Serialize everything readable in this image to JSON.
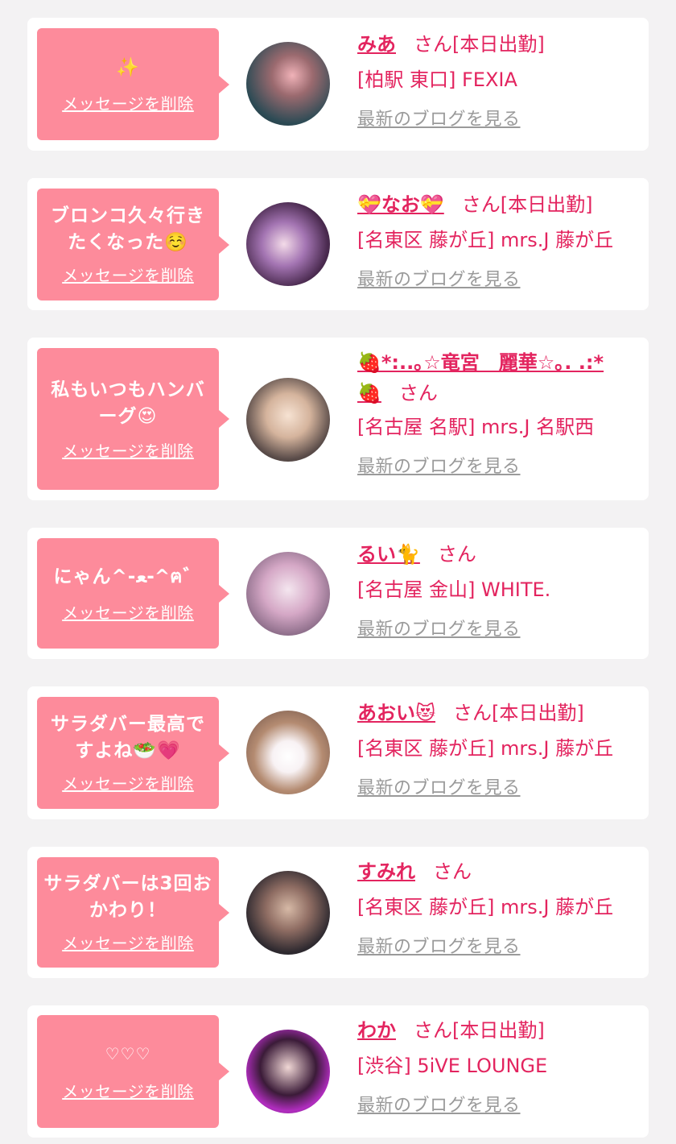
{
  "delete_label": "メッセージを削除",
  "blog_label": "最新のブログを見る",
  "san_label": "さん",
  "cards": [
    {
      "message": "✨",
      "name": "みあ",
      "status": "[本日出勤]",
      "shop": "[柏駅 東口] FEXIA"
    },
    {
      "message": "ブロンコ久々行きたくなった☺️",
      "name": "💝なお💝",
      "status": "[本日出勤]",
      "shop": "[名東区 藤が丘] mrs.J 藤が丘"
    },
    {
      "message": "私もいつもハンバーグ😍",
      "name": "🍓*:..｡☆竜宮　麗華☆｡. .:*🍓",
      "status": "",
      "shop": "[名古屋 名駅] mrs.J 名駅西"
    },
    {
      "message": "にゃん^-ﻌ-^ฅ゛",
      "name": "るい🐈",
      "status": "",
      "shop": "[名古屋 金山] WHITE."
    },
    {
      "message": "サラダバー最高ですよね🥗💗",
      "name": "あおい😻",
      "status": "[本日出勤]",
      "shop": "[名東区 藤が丘] mrs.J 藤が丘"
    },
    {
      "message": "サラダバーは3回おかわり！",
      "name": "すみれ",
      "status": "",
      "shop": "[名東区 藤が丘] mrs.J 藤が丘"
    },
    {
      "message": "♡♡♡",
      "name": "わか",
      "status": "[本日出勤]",
      "shop": "[渋谷] 5iVE LOUNGE"
    }
  ]
}
